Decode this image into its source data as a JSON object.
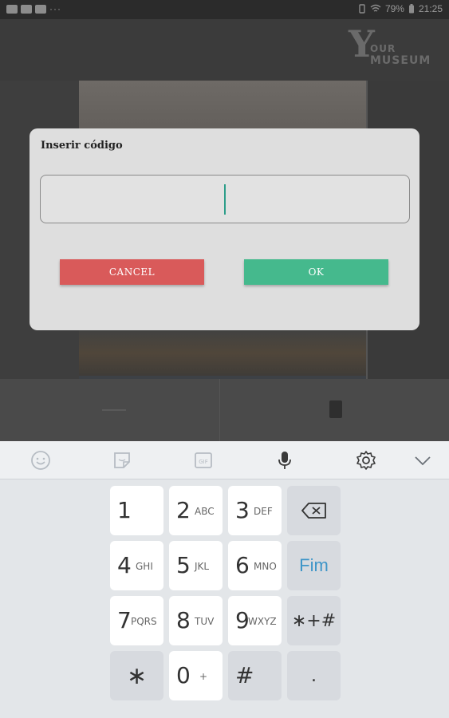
{
  "status_bar": {
    "battery": "79%",
    "time": "21:25",
    "more": "···"
  },
  "app": {
    "logo_y": "Y",
    "logo_our": "OUR",
    "logo_museum": "MUSEUM"
  },
  "dialog": {
    "title": "Inserir código",
    "input_value": "",
    "cancel_label": "CANCEL",
    "ok_label": "OK",
    "cancel_color": "#d95a5a",
    "ok_color": "#45b98d"
  },
  "keyboard_toolbar": {
    "icons": [
      "emoji-icon",
      "sticker-icon",
      "gif-icon",
      "microphone-icon",
      "settings-icon",
      "collapse-keyboard-icon"
    ]
  },
  "keyboard": {
    "keys": [
      {
        "num": "1",
        "letters": ""
      },
      {
        "num": "2",
        "letters": "ABC"
      },
      {
        "num": "3",
        "letters": "DEF"
      },
      {
        "num": "4",
        "letters": "GHI"
      },
      {
        "num": "5",
        "letters": "JKL"
      },
      {
        "num": "6",
        "letters": "MNO"
      },
      {
        "num": "7",
        "letters": "PQRS"
      },
      {
        "num": "8",
        "letters": "TUV"
      },
      {
        "num": "9",
        "letters": "WXYZ"
      },
      {
        "num": "0",
        "letters": "+"
      }
    ],
    "star": "∗",
    "hash": "#",
    "fim": "Fim",
    "symbols": "∗+#",
    "period": "."
  }
}
